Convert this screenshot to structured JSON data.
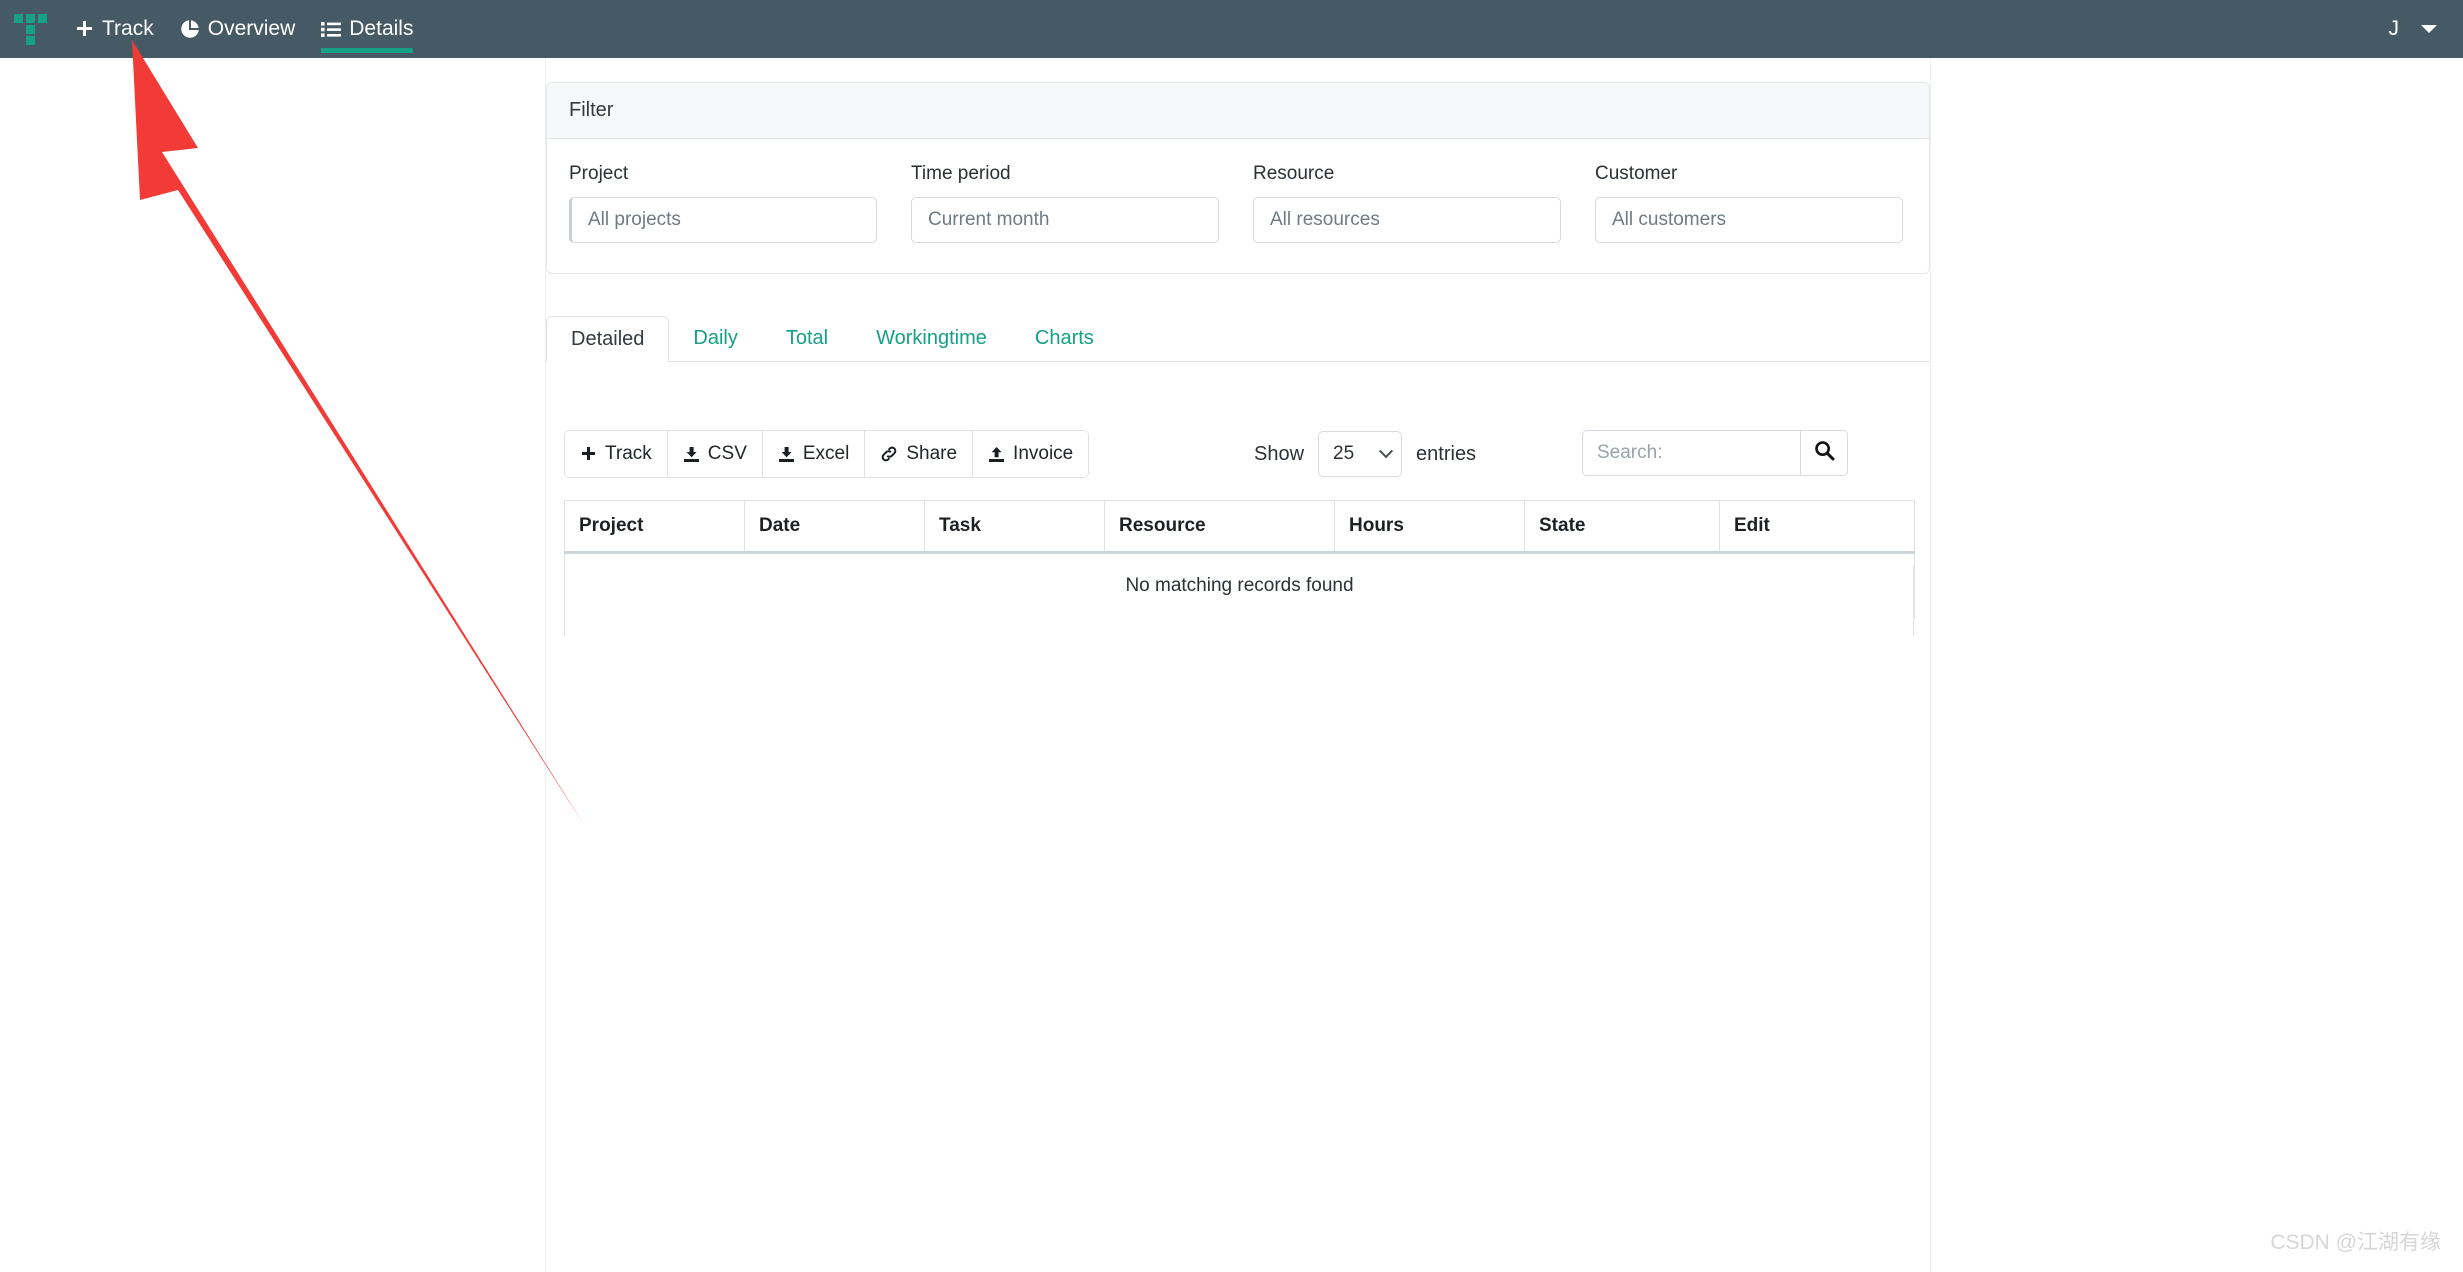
{
  "navbar": {
    "brand_icon": "timetracker-logo-icon",
    "items": [
      {
        "label": "Track",
        "icon": "plus-icon",
        "active": false
      },
      {
        "label": "Overview",
        "icon": "pie-chart-icon",
        "active": false
      },
      {
        "label": "Details",
        "icon": "list-icon",
        "active": true
      }
    ],
    "user_initial": "J",
    "user_caret_icon": "caret-down-icon",
    "background_color": "#465a65",
    "accent_color": "#16a085"
  },
  "filter": {
    "title": "Filter",
    "fields": [
      {
        "label": "Project",
        "value": "All projects",
        "placeholder": "All projects"
      },
      {
        "label": "Time period",
        "value": "Current month",
        "placeholder": "Current month"
      },
      {
        "label": "Resource",
        "value": "All resources",
        "placeholder": "All resources"
      },
      {
        "label": "Customer",
        "value": "All customers",
        "placeholder": "All customers"
      }
    ]
  },
  "tabs": [
    {
      "label": "Detailed",
      "active": true
    },
    {
      "label": "Daily",
      "active": false
    },
    {
      "label": "Total",
      "active": false
    },
    {
      "label": "Workingtime",
      "active": false
    },
    {
      "label": "Charts",
      "active": false
    }
  ],
  "toolbar": {
    "buttons": [
      {
        "label": "Track",
        "icon": "plus-icon"
      },
      {
        "label": "CSV",
        "icon": "download-icon"
      },
      {
        "label": "Excel",
        "icon": "download-icon"
      },
      {
        "label": "Share",
        "icon": "link-icon"
      },
      {
        "label": "Invoice",
        "icon": "upload-icon"
      }
    ],
    "show_label": "Show",
    "entries_value": "25",
    "entries_label": "entries",
    "search_placeholder": "Search:",
    "search_value": "",
    "search_icon": "search-icon"
  },
  "table": {
    "columns": [
      "Project",
      "Date",
      "Task",
      "Resource",
      "Hours",
      "State",
      "Edit"
    ],
    "rows": [],
    "empty_message": "No matching records found"
  },
  "annotation": {
    "color": "#f23b36",
    "target": "Track"
  },
  "watermark": {
    "text": "CSDN @江湖有缘"
  }
}
